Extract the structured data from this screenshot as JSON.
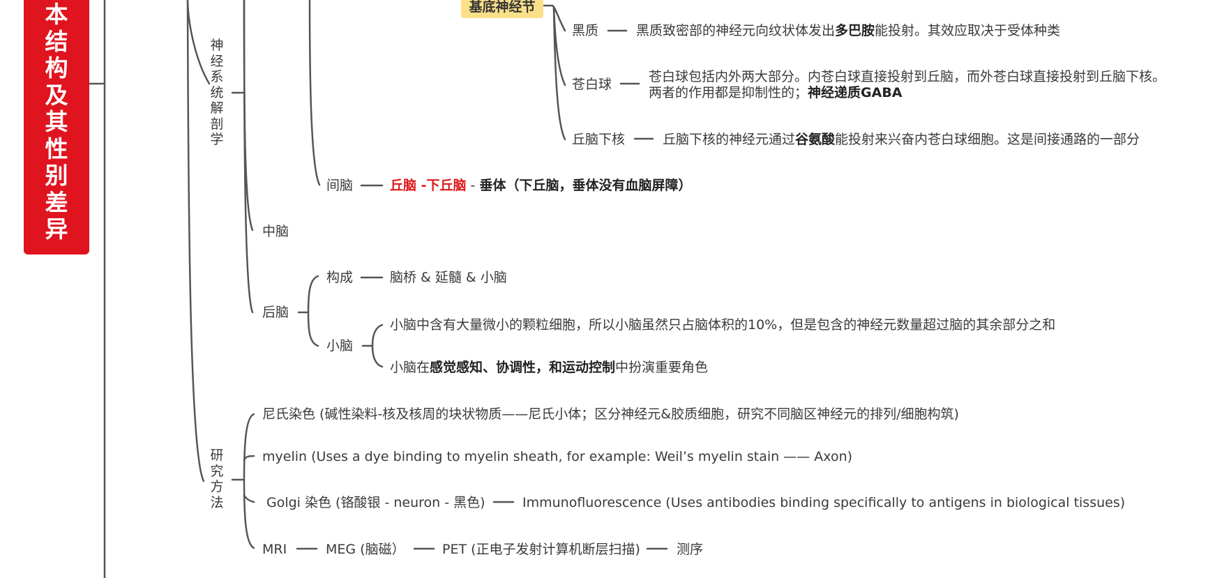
{
  "root": {
    "title": "本结构及其性别差异"
  },
  "anatomy": {
    "label": "神经系统解剖学"
  },
  "basal_ganglia": {
    "tag": "基底神经节",
    "heizhi": {
      "label": "黑质",
      "pre": "黑质致密部的神经元向纹状体发出",
      "bold": "多巴胺",
      "post": "能投射。其效应取决于受体种类"
    },
    "cangbaiqiu": {
      "label": "苍白球",
      "line1": "苍白球包括内外两大部分。内苍白球直接投射到丘脑，而外苍白球直接投射到丘脑下核。",
      "line2_pre": "两者的作用都是抑制性的；",
      "line2_bold": "神经递质GABA"
    },
    "qiunaoxiahe": {
      "label": "丘脑下核",
      "pre": "丘脑下核的神经元通过",
      "bold": "谷氨酸",
      "post": "能投射来兴奋内苍白球细胞。这是间接通路的一部分"
    }
  },
  "jiannao": {
    "label": "间脑",
    "red": "丘脑 -下丘脑",
    "sep": " - ",
    "bold": "垂体（下丘脑，垂体没有血脑屏障）"
  },
  "zhongnao": {
    "label": "中脑"
  },
  "hounao": {
    "label": "后脑",
    "goucheng": {
      "label": "构成",
      "text": "脑桥 & 延髓 & 小脑"
    },
    "xiaonao": {
      "label": "小脑",
      "item1": "小脑中含有大量微小的颗粒细胞，所以小脑虽然只占脑体积的10%，但是包含的神经元数量超过脑的其余部分之和",
      "item2_pre": "小脑在",
      "item2_bold": "感觉感知、协调性，和运动控制",
      "item2_post": "中扮演重要角色"
    }
  },
  "methods": {
    "label": "研究方法",
    "nissl": "尼氏染色 (碱性染料-核及核周的块状物质——尼氏小体；区分神经元&胶质细胞，研究不同脑区神经元的排列/细胞构筑)",
    "myelin": "myelin (Uses a dye binding to myelin sheath, for example: Weil’s myelin stain —— Axon)",
    "golgi": "Golgi 染色 (铬酸银 - neuron - 黑色)",
    "immuno": "Immunofluorescence (Uses antibodies binding specifically to antigens in biological tissues)",
    "mri": "MRI",
    "meg": "MEG (脑磁）",
    "pet": "PET (正电子发射计算机断层扫描)",
    "cexu": "测序"
  }
}
